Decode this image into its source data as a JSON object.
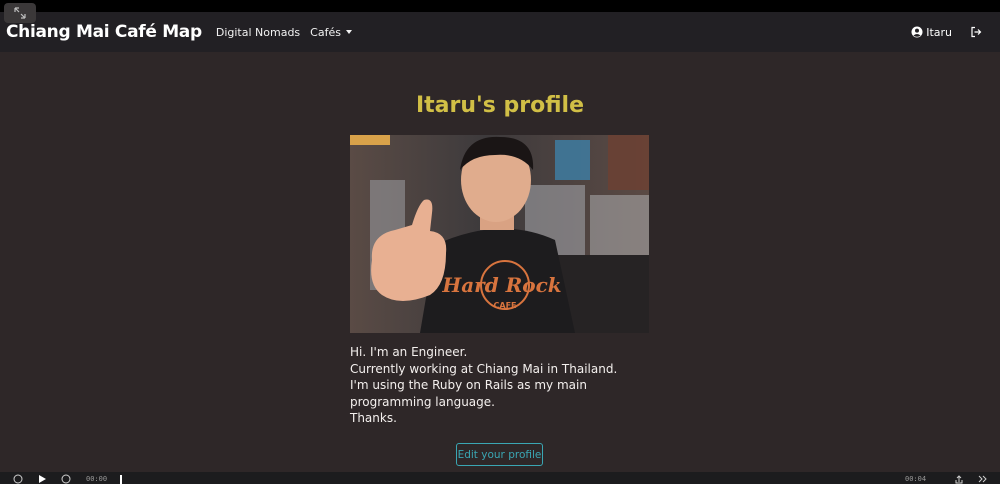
{
  "navbar": {
    "brand": "Chiang Mai Café Map",
    "links": [
      "Digital Nomads",
      "Cafés"
    ],
    "user_name": "Itaru"
  },
  "profile": {
    "title": "Itaru's profile",
    "bio_lines": [
      "Hi. I'm an Engineer.",
      "Currently working at Chiang Mai in Thailand.",
      "I'm using the Ruby on Rails as my main programming language.",
      "Thanks."
    ],
    "photo_shirt_text": "Hard Rock",
    "photo_shirt_sub": "CAFE",
    "edit_button": "Edit your profile"
  },
  "player": {
    "time_current": "00:00",
    "time_total": "00:04"
  },
  "icons": {
    "expand": "expand-icon",
    "user": "user-circle-icon",
    "logout": "logout-icon",
    "replay": "replay-icon",
    "play": "play-icon",
    "forward": "forward-icon",
    "share": "share-icon",
    "next": "double-chevron-icon"
  },
  "colors": {
    "background": "#2e2728",
    "navbar": "#222024",
    "title": "#d1bf46",
    "button": "#3aa6b3"
  }
}
